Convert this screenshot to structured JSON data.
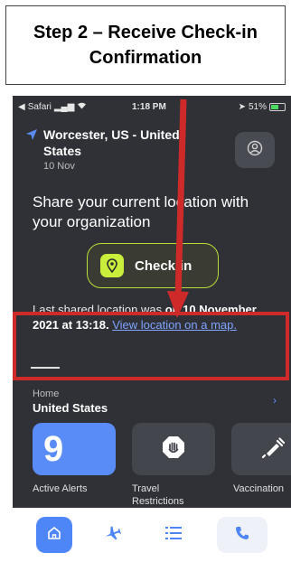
{
  "caption": {
    "title": "Step 2 – Receive Check-in Confirmation"
  },
  "status_bar": {
    "back_label": "Safari",
    "time": "1:18 PM",
    "battery": "51%"
  },
  "location": {
    "title": "Worcester, US - United States",
    "date": "10 Nov"
  },
  "share": {
    "text": "Share your current location with your organization"
  },
  "checkin": {
    "label": "Check-in"
  },
  "last_shared": {
    "prefix": "Last shared location was ",
    "bold": "on 10 November, 2021 at 13:18.",
    "link": "View location on a map."
  },
  "home": {
    "label": "Home",
    "country": "United States"
  },
  "tiles": {
    "alerts_count": "9",
    "alerts_label": "Active Alerts",
    "travel_label": "Travel Restrictions",
    "vacc_label": "Vaccination"
  },
  "colors": {
    "accent": "#5a8cf7",
    "checkin": "#c9ef3c",
    "annotation": "#cf2a2a",
    "background": "#2f3137"
  }
}
